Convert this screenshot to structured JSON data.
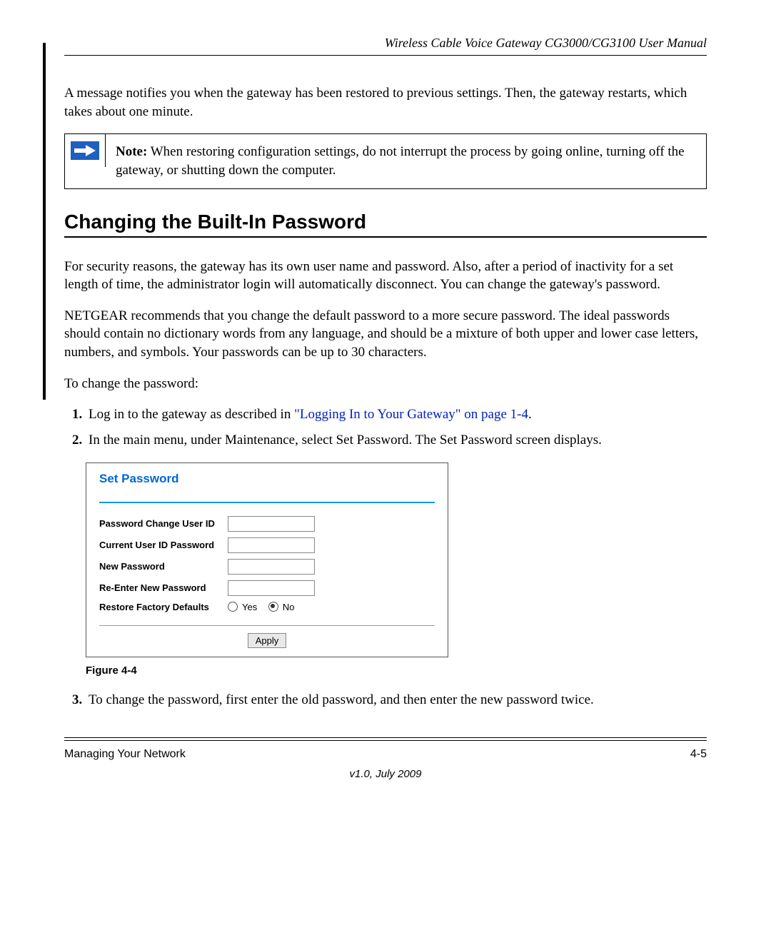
{
  "header": {
    "title": "Wireless Cable Voice Gateway CG3000/CG3100 User Manual"
  },
  "intro_paragraph": "A message notifies you when the gateway has been restored to previous settings. Then, the gateway restarts, which takes about one minute.",
  "note": {
    "label": "Note:",
    "text": " When restoring configuration settings, do not interrupt the process by going online, turning off the gateway, or shutting down the computer."
  },
  "section_heading": "Changing the Built-In Password",
  "para1": "For security reasons, the gateway has its own user name and password. Also, after a period of inactivity for a set length of time, the administrator login will automatically disconnect. You can change the gateway's password.",
  "para2": "NETGEAR recommends that you change the default password to a more secure password. The ideal passwords should contain no dictionary words from any language, and should be a mixture of both upper and lower case letters, numbers, and symbols. Your passwords can be up to 30 characters.",
  "para3": "To change the password:",
  "steps": {
    "s1_prefix": "Log in to the gateway as described in ",
    "s1_link": "\"Logging In to Your Gateway\" on page 1-4",
    "s1_suffix": ".",
    "s2": "In the main menu, under Maintenance, select Set Password. The Set Password screen displays.",
    "s3": "To change the password, first enter the old password, and then enter the new password twice."
  },
  "figure": {
    "caption": "Figure 4-4",
    "title": "Set Password",
    "fields": {
      "user_id": "Password Change User ID",
      "current_pw": "Current User ID Password",
      "new_pw": "New Password",
      "reenter_pw": "Re-Enter New Password",
      "restore_defaults": "Restore Factory Defaults",
      "yes": "Yes",
      "no": "No"
    },
    "apply": "Apply"
  },
  "footer": {
    "left": "Managing Your Network",
    "right": "4-5",
    "version": "v1.0, July 2009"
  }
}
